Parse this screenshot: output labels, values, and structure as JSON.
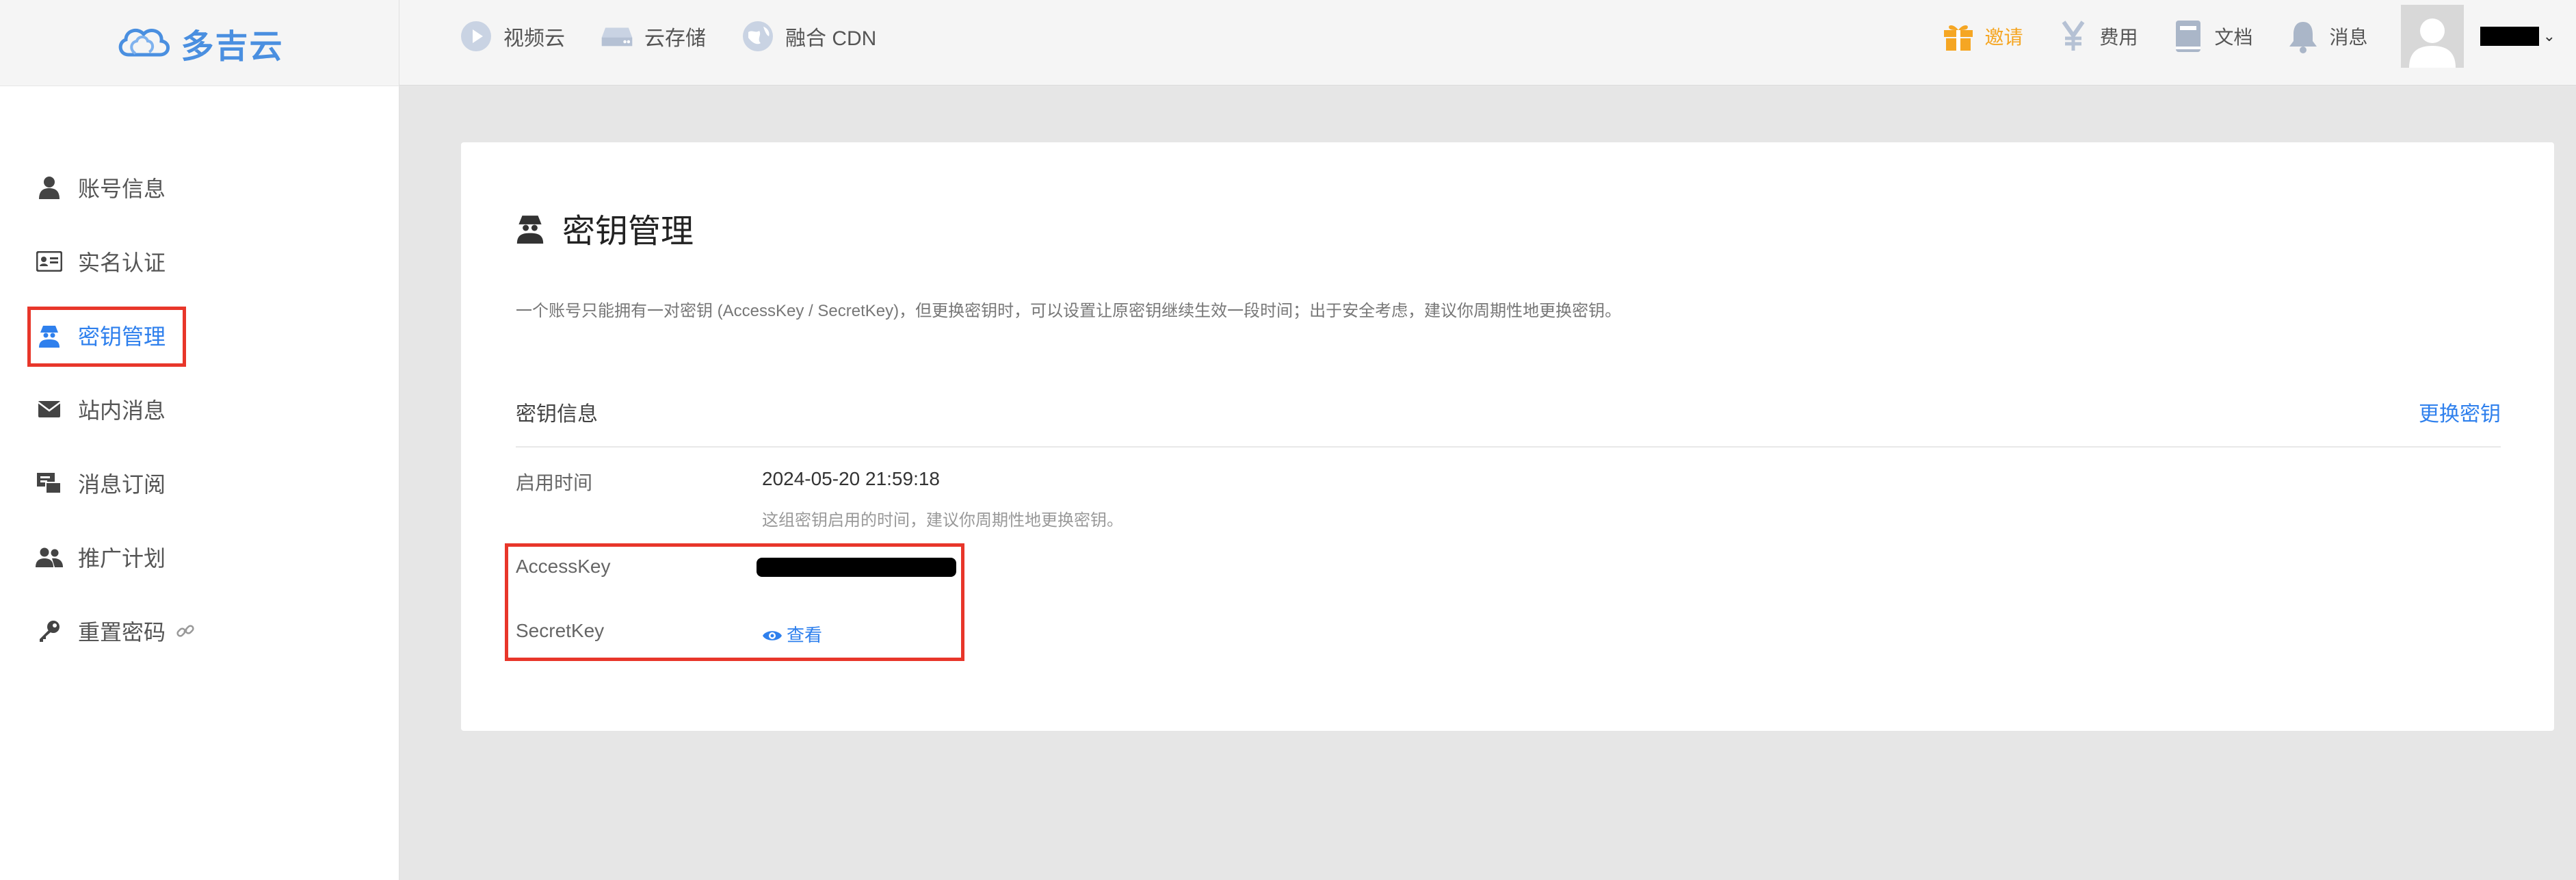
{
  "brand": {
    "name": "多吉云",
    "color": "#4a8fe0"
  },
  "topnav": {
    "items": [
      {
        "label": "视频云",
        "icon": "play-circle-icon"
      },
      {
        "label": "云存储",
        "icon": "storage-icon"
      },
      {
        "label": "融合 CDN",
        "icon": "globe-icon"
      }
    ]
  },
  "topright": {
    "items": [
      {
        "label": "邀请",
        "icon": "gift-icon",
        "color": "#f5a623"
      },
      {
        "label": "费用",
        "icon": "yen-icon"
      },
      {
        "label": "文档",
        "icon": "book-icon"
      },
      {
        "label": "消息",
        "icon": "bell-icon"
      }
    ]
  },
  "sidebar": {
    "items": [
      {
        "label": "账号信息",
        "icon": "user-icon"
      },
      {
        "label": "实名认证",
        "icon": "id-card-icon"
      },
      {
        "label": "密钥管理",
        "icon": "user-secret-icon",
        "active": true
      },
      {
        "label": "站内消息",
        "icon": "envelope-icon"
      },
      {
        "label": "消息订阅",
        "icon": "subscription-icon"
      },
      {
        "label": "推广计划",
        "icon": "users-icon"
      },
      {
        "label": "重置密码",
        "icon": "key-icon",
        "suffix_icon": "link-icon"
      }
    ]
  },
  "main": {
    "title": "密钥管理",
    "description": "一个账号只能拥有一对密钥 (AccessKey / SecretKey)，但更换密钥时，可以设置让原密钥继续生效一段时间；出于安全考虑，建议你周期性地更换密钥。",
    "section": {
      "title": "密钥信息",
      "action": "更换密钥"
    },
    "fields": {
      "enabled_time": {
        "label": "启用时间",
        "value": "2024-05-20 21:59:18",
        "hint": "这组密钥启用的时间，建议你周期性地更换密钥。"
      },
      "access_key": {
        "label": "AccessKey"
      },
      "secret_key": {
        "label": "SecretKey",
        "action": "查看"
      }
    }
  },
  "colors": {
    "accent": "#2f80ed",
    "highlight": "#e8362a",
    "invite": "#f5a623"
  }
}
